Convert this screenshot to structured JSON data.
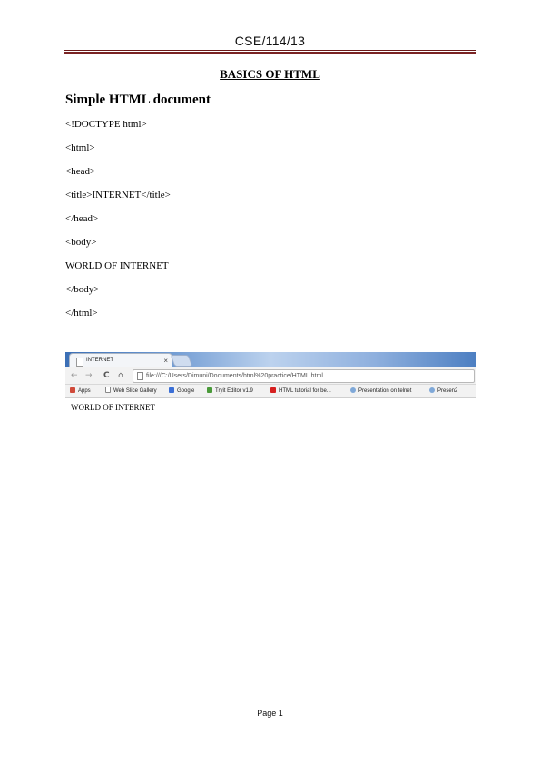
{
  "header": {
    "title": "CSE/114/13"
  },
  "document": {
    "heading": "BASICS OF HTML",
    "subheading": "Simple HTML document",
    "code_lines": [
      "<!DOCTYPE html>",
      "<html>",
      "<head>",
      "<title>INTERNET</title>",
      "</head>",
      "<body>",
      "WORLD OF INTERNET",
      "</body>",
      "</html>"
    ]
  },
  "browser": {
    "tab_title": "INTERNET",
    "tab_close": "×",
    "nav": {
      "back": "←",
      "forward": "→",
      "reload": "C",
      "home": "⌂"
    },
    "url": "file:///C:/Users/Dimuni/Documents/html%20practice/HTML.html",
    "bookmarks": [
      {
        "label": "Apps",
        "color": "#d04a3a"
      },
      {
        "label": "Web Slice Gallery",
        "color": "#ffffff"
      },
      {
        "label": "Google",
        "color": "#3b6fd6"
      },
      {
        "label": "Tryit Editor v1.9",
        "color": "#4a9a3a"
      },
      {
        "label": "HTML tutorial for be...",
        "color": "#d62020"
      },
      {
        "label": "Presentation on telnet",
        "color": "#7fa8d8"
      },
      {
        "label": "Presen2",
        "color": "#7fa8d8"
      }
    ],
    "page_text": "WORLD OF INTERNET"
  },
  "footer": {
    "page": "Page 1"
  }
}
